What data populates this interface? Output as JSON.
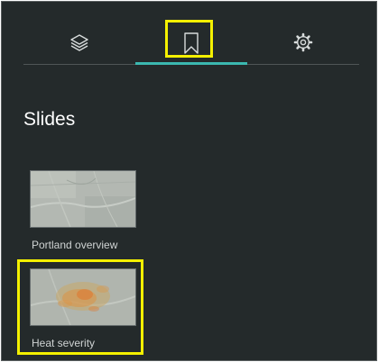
{
  "tabs": [
    {
      "icon": "layers-icon"
    },
    {
      "icon": "bookmark-icon",
      "active": true
    },
    {
      "icon": "gear-icon"
    }
  ],
  "accent_color": "#3bb8b0",
  "highlight_color": "#f4f000",
  "panel_background": "#242a2b",
  "heading": "Slides",
  "slides": [
    {
      "caption": "Portland overview",
      "thumbnail": "map-thumbnail"
    },
    {
      "caption": "Heat severity",
      "thumbnail": "heat-map-thumbnail",
      "highlighted": true
    }
  ]
}
